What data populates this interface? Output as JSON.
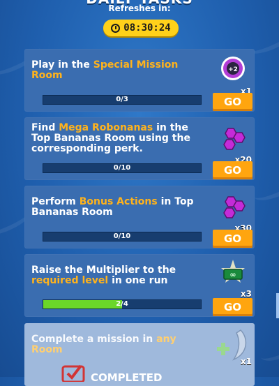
{
  "header": {
    "title": "DAILY TASKS",
    "refresh_label": "Refreshes in:",
    "timer": "08:30:24"
  },
  "tasks": [
    {
      "parts": [
        "Play in the ",
        "Special Mission Room",
        ""
      ],
      "progress": "0/3",
      "progress_fraction": 0,
      "reward_icon": "special-mission-token-icon",
      "reward_count": "x1",
      "button": "GO"
    },
    {
      "parts": [
        "Find ",
        "Mega Robonanas",
        " in the Top Bananas Room using the corresponding perk."
      ],
      "progress": "0/10",
      "progress_fraction": 0,
      "reward_icon": "purple-gems-icon",
      "reward_count": "x20",
      "button": "GO"
    },
    {
      "parts": [
        "Perform ",
        "Bonus Actions",
        " in Top Bananas Room"
      ],
      "progress": "0/10",
      "progress_fraction": 0,
      "reward_icon": "purple-gems-icon",
      "reward_count": "x30",
      "button": "GO"
    },
    {
      "parts": [
        "Raise the Multiplier to the ",
        "required level",
        " in one run"
      ],
      "progress_value": "2",
      "progress_max": "/4",
      "progress_fraction": 0.5,
      "reward_icon": "infinity-ticket-icon",
      "reward_count": "x3",
      "button": "GO"
    },
    {
      "parts": [
        "Complete a mission in ",
        "any Room",
        ""
      ],
      "reward_icon": "banana-plus-icon",
      "reward_count": "x1",
      "status": "COMPLETED"
    }
  ],
  "colors": {
    "highlight": "#ffb31c",
    "go_button": "#ffa50f",
    "progress_fill": "#6bd629",
    "timer_bg": "#ffd11a"
  }
}
